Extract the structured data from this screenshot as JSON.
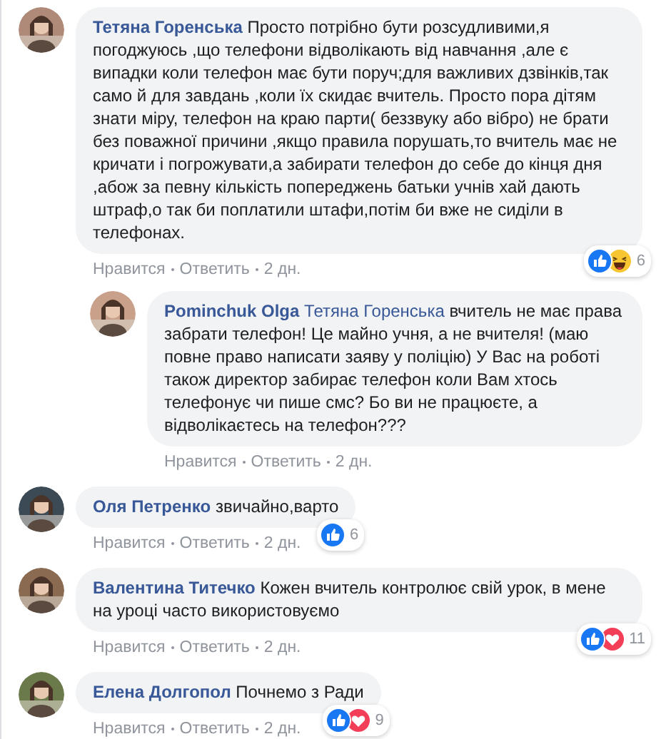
{
  "comments": [
    {
      "author": "Тетяна Горенська",
      "text": "Просто потрібно бути розсудливими,я погоджуюсь ,що телефони відволікають від навчання ,але є випадки коли телефон має бути поруч;для важливих дзвінків,так само й для завдань ,коли їх скидає вчитель. Просто пора дітям знати міру, телефон на краю парти( беззвуку або вібро) не брати без поважної причини ,якщо правила порушать,то вчитель має не кричати і погрожувати,а забирати телефон до себе до кінця дня ,абож за певну кількість попереджень батьки учнів хай дають штраф,о так би поплатили штафи,потім би вже не сиділи в телефонах.",
      "reactions": [
        {
          "kind": "like"
        },
        {
          "kind": "haha"
        }
      ],
      "reaction_count": "6",
      "actions": [
        "Нравится",
        "Ответить",
        "2 дн."
      ],
      "children": [
        {
          "author": "Pominchuk Olga",
          "mention": "Тетяна Горенська",
          "text": "вчитель не має права забрати телефон! Це майно учня, а не вчителя! (маю повне право написати заяву у поліцію) У Вас на роботі також директор забирає телефон коли Вам хтось телефонує чи пише смс? Бо ви не працюєте, а відволікаєтесь на телефон???",
          "actions": [
            "Нравится",
            "Ответить",
            "2 дн."
          ]
        }
      ]
    },
    {
      "author": "Оля Петренко",
      "text": "звичайно,варто",
      "reactions": [
        {
          "kind": "like"
        }
      ],
      "reaction_count": "6",
      "actions": [
        "Нравится",
        "Ответить",
        "2 дн."
      ]
    },
    {
      "author": "Валентина Титечко",
      "text": "Кожен вчитель контролює свій урок, в мене на уроці часто використовуємо",
      "reactions": [
        {
          "kind": "like"
        },
        {
          "kind": "love"
        }
      ],
      "reaction_count": "11",
      "actions": [
        "Нравится",
        "Ответить",
        "2 дн."
      ]
    },
    {
      "author": "Елена Долгопол",
      "text": "Почнемо з Ради",
      "reactions": [
        {
          "kind": "like"
        },
        {
          "kind": "love"
        }
      ],
      "reaction_count": "9",
      "actions": [
        "Нравится",
        "Ответить",
        "2 дн."
      ]
    }
  ]
}
